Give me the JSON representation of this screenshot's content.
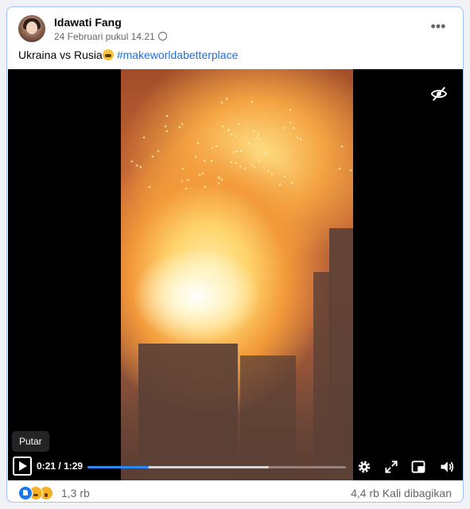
{
  "post": {
    "author": "Idawati Fang",
    "timestamp": "24 Februari pukul 14.21",
    "audience_icon": "globe-icon",
    "caption_text": "Ukraina vs Rusia",
    "caption_emoji": "crying-face-emoji",
    "hashtag": "#makeworldabetterplace",
    "more_icon": "more-options-icon",
    "more_glyph": "•••"
  },
  "video": {
    "tooltip": "Putar",
    "current_time": "0:21",
    "separator": "/",
    "duration": "1:29",
    "progress_fraction": 0.236,
    "buffered_fraction": 0.7,
    "icons": [
      "hide-icon",
      "play-icon",
      "settings-icon",
      "fullscreen-icon",
      "miniplayer-icon",
      "volume-icon"
    ]
  },
  "footer": {
    "reaction_icons": [
      "like-reaction-icon",
      "sad-reaction-icon",
      "wow-reaction-icon"
    ],
    "reaction_count": "1,3 rb",
    "shares": "4,4 rb Kali dibagikan"
  },
  "colors": {
    "card_border": "#9ec2f3",
    "hashtag": "#216fdb",
    "progress": "#2d88ff",
    "like": "#1877f2"
  }
}
